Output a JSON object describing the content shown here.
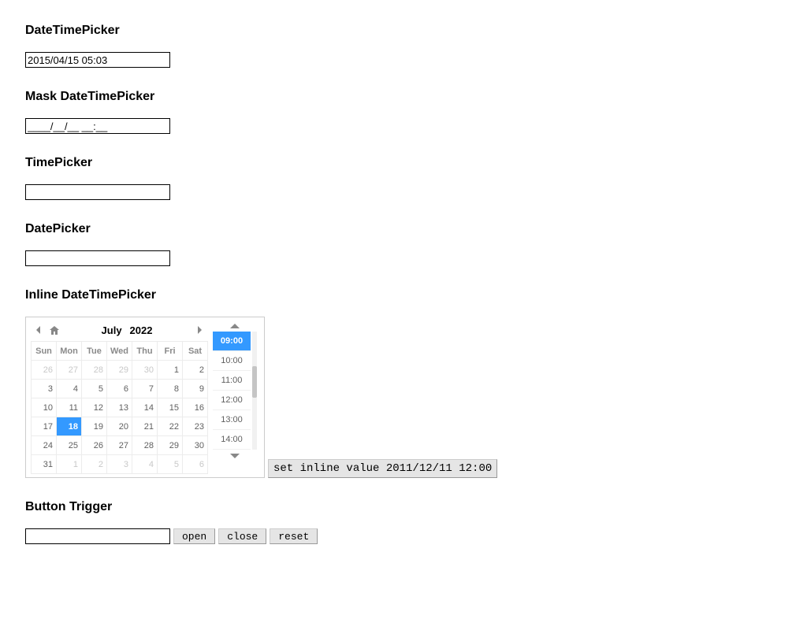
{
  "sections": {
    "datetimepicker": {
      "heading": "DateTimePicker",
      "value": "2015/04/15 05:03"
    },
    "mask": {
      "heading": "Mask DateTimePicker",
      "value": "____/__/__ __:__"
    },
    "timepicker": {
      "heading": "TimePicker",
      "value": ""
    },
    "datepicker": {
      "heading": "DatePicker",
      "value": ""
    },
    "inline": {
      "heading": "Inline DateTimePicker",
      "button_label": "set inline value 2011/12/11 12:00"
    },
    "trigger": {
      "heading": "Button Trigger",
      "value": "",
      "open_label": "open",
      "close_label": "close",
      "reset_label": "reset"
    }
  },
  "calendar": {
    "month": "July",
    "year": "2022",
    "dow": [
      "Sun",
      "Mon",
      "Tue",
      "Wed",
      "Thu",
      "Fri",
      "Sat"
    ],
    "rows": [
      [
        {
          "d": "26",
          "o": true
        },
        {
          "d": "27",
          "o": true
        },
        {
          "d": "28",
          "o": true
        },
        {
          "d": "29",
          "o": true
        },
        {
          "d": "30",
          "o": true
        },
        {
          "d": "1"
        },
        {
          "d": "2"
        }
      ],
      [
        {
          "d": "3"
        },
        {
          "d": "4"
        },
        {
          "d": "5"
        },
        {
          "d": "6"
        },
        {
          "d": "7"
        },
        {
          "d": "8"
        },
        {
          "d": "9"
        }
      ],
      [
        {
          "d": "10"
        },
        {
          "d": "11"
        },
        {
          "d": "12"
        },
        {
          "d": "13"
        },
        {
          "d": "14"
        },
        {
          "d": "15"
        },
        {
          "d": "16"
        }
      ],
      [
        {
          "d": "17"
        },
        {
          "d": "18",
          "sel": true
        },
        {
          "d": "19"
        },
        {
          "d": "20"
        },
        {
          "d": "21"
        },
        {
          "d": "22"
        },
        {
          "d": "23"
        }
      ],
      [
        {
          "d": "24"
        },
        {
          "d": "25"
        },
        {
          "d": "26"
        },
        {
          "d": "27"
        },
        {
          "d": "28"
        },
        {
          "d": "29"
        },
        {
          "d": "30"
        }
      ],
      [
        {
          "d": "31"
        },
        {
          "d": "1",
          "o": true
        },
        {
          "d": "2",
          "o": true
        },
        {
          "d": "3",
          "o": true
        },
        {
          "d": "4",
          "o": true
        },
        {
          "d": "5",
          "o": true
        },
        {
          "d": "6",
          "o": true
        }
      ]
    ]
  },
  "times": [
    {
      "t": "09:00",
      "sel": true
    },
    {
      "t": "10:00"
    },
    {
      "t": "11:00"
    },
    {
      "t": "12:00"
    },
    {
      "t": "13:00"
    },
    {
      "t": "14:00"
    }
  ]
}
